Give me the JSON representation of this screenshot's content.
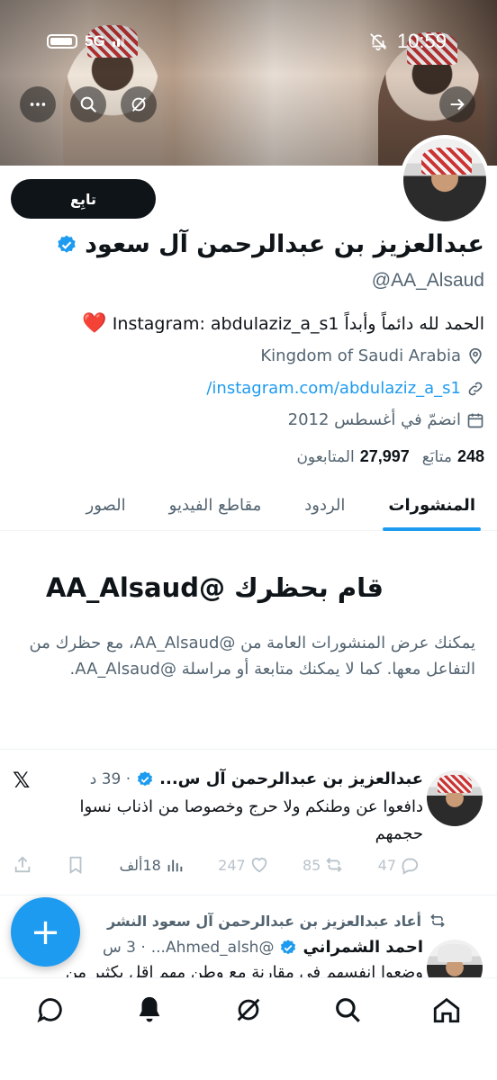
{
  "status_bar": {
    "network": "5G",
    "time": "10:59"
  },
  "banner": {
    "back_icon": "arrow-right-icon",
    "more_icon": "more-icon",
    "search_icon": "search-icon",
    "grok_icon": "grok-icon"
  },
  "profile": {
    "follow_label": "تابِع",
    "name": "عبدالعزيز بن عبدالرحمن آل سعود",
    "handle": "@AA_Alsaud",
    "bio": "الحمد لله دائماً وأبداً Instagram: abdulaziz_a_s1",
    "bio_emoji": "❤️",
    "location": "Kingdom of Saudi Arabia",
    "website": "instagram.com/abdulaziz_a_s1/",
    "joined": "انضمّ في أغسطس 2012",
    "following_count": "248",
    "following_label": "متابَع",
    "followers_count": "27,997",
    "followers_label": "المتابعون"
  },
  "tabs": [
    {
      "label": "المنشورات"
    },
    {
      "label": "الردود"
    },
    {
      "label": "مقاطع الفيديو"
    },
    {
      "label": "الصور"
    }
  ],
  "blocked": {
    "title": "قام بحظرك @AA_Alsaud",
    "text": "يمكنك عرض المنشورات العامة من @AA_Alsaud، مع حظرك من التفاعل معها. كما لا يمكنك متابعة أو مراسلة @AA_Alsaud."
  },
  "tweet": {
    "author": "عبدالعزيز بن عبدالرحمن آل س...",
    "time": "· 39 د",
    "body": "دافعوا عن وطنكم ولا حرج وخصوصا من اذناب نسوا حجمهم",
    "replies": "47",
    "retweets": "85",
    "likes": "247",
    "views": "18ألف"
  },
  "retweet": {
    "label": "أعاد عبدالعزيز بن عبدالرحمن آل سعود النشر",
    "author": "احمد الشمراني",
    "handle": "@Ahmed_alsh...",
    "time": "· 3 س",
    "body": "وضعوا انفسهم في مقارنة مع وطن مهم اقل بكثير من"
  },
  "nav": [
    "home-icon",
    "search-icon",
    "grok-icon",
    "notifications-icon",
    "messages-icon"
  ]
}
